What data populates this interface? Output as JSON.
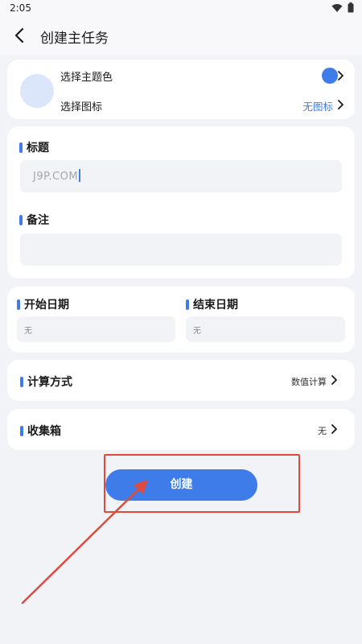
{
  "status_bar": {
    "time": "2:05"
  },
  "header": {
    "title": "创建主任务"
  },
  "theme": {
    "choose_color_label": "选择主题色",
    "choose_icon_label": "选择图标",
    "icon_value": "无图标",
    "theme_color": "#3e7de9"
  },
  "form": {
    "title_label": "标题",
    "title_value": "J9P.COM",
    "note_label": "备注",
    "note_value": ""
  },
  "dates": {
    "start_label": "开始日期",
    "start_value": "无",
    "end_label": "结束日期",
    "end_value": "无"
  },
  "calc": {
    "label": "计算方式",
    "value": "数值计算"
  },
  "inbox": {
    "label": "收集箱",
    "value": "无"
  },
  "create_button": {
    "label": "创建"
  },
  "icons": [
    "back-arrow-icon",
    "wifi-icon",
    "battery-icon",
    "chevron-right-icon"
  ],
  "annotation_color": "#e04a3c"
}
